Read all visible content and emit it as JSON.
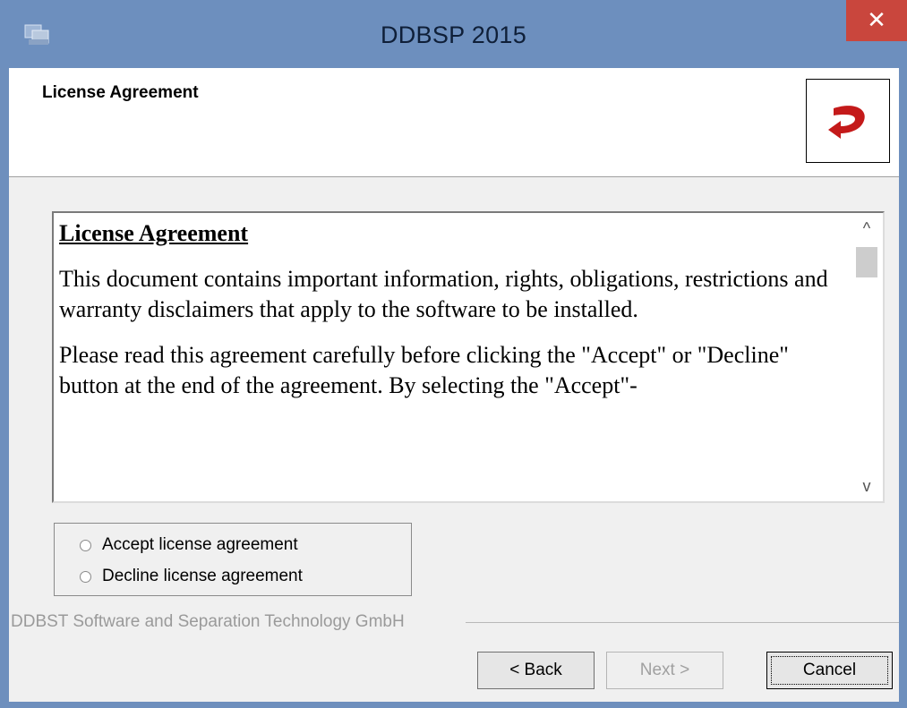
{
  "window": {
    "title": "DDBSP 2015",
    "close_label": "✕"
  },
  "header": {
    "title": "License Agreement"
  },
  "license": {
    "heading": "License Agreement",
    "para1": "This document contains important information, rights, obligations, restrictions and warranty disclaimers that apply to the software to be installed.",
    "para2": "Please read this agreement carefully before clicking the \"Accept\" or \"Decline\" button at the end of the agreement. By selecting the \"Accept\"-"
  },
  "scrollbar": {
    "up_icon": "^",
    "down_icon": "v"
  },
  "options": {
    "accept_label": "Accept license agreement",
    "decline_label": "Decline license agreement"
  },
  "footer": {
    "company": "DDBST Software and Separation Technology GmbH"
  },
  "buttons": {
    "back": "< Back",
    "next": "Next >",
    "cancel": "Cancel"
  },
  "colors": {
    "title_bar": "#6d8fbe",
    "close_button": "#c9463d",
    "logo_red": "#c41a1a"
  },
  "icons": {
    "app": "installer-app-icon",
    "logo": "ddbst-logo-icon"
  }
}
